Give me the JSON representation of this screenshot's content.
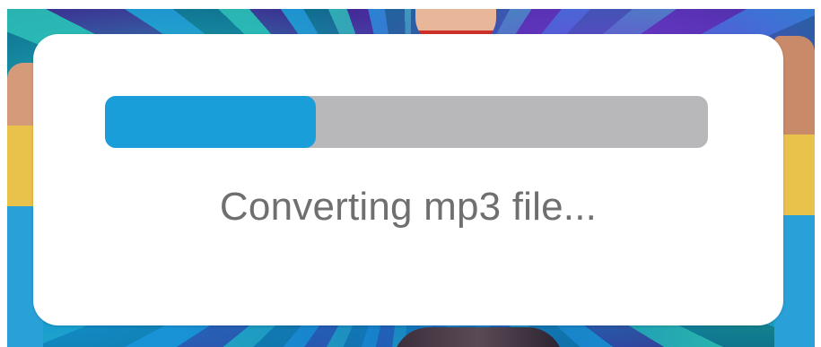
{
  "dialog": {
    "status_text": "Converting mp3 file...",
    "progress": 0.35
  },
  "colors": {
    "progress_fill": "#1a9ed9",
    "progress_track": "#b8b8ba",
    "status_text": "#6f6f6f",
    "dialog_background": "#ffffff"
  }
}
